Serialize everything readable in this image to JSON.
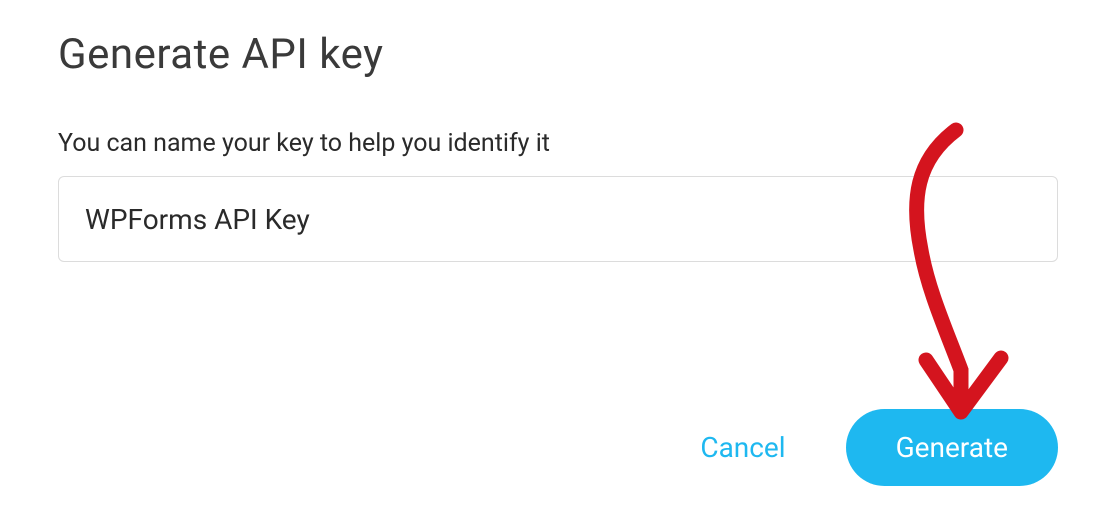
{
  "dialog": {
    "title": "Generate API key",
    "field_label": "You can name your key to help you identify it",
    "input_value": "WPForms API Key",
    "cancel_label": "Cancel",
    "generate_label": "Generate"
  }
}
